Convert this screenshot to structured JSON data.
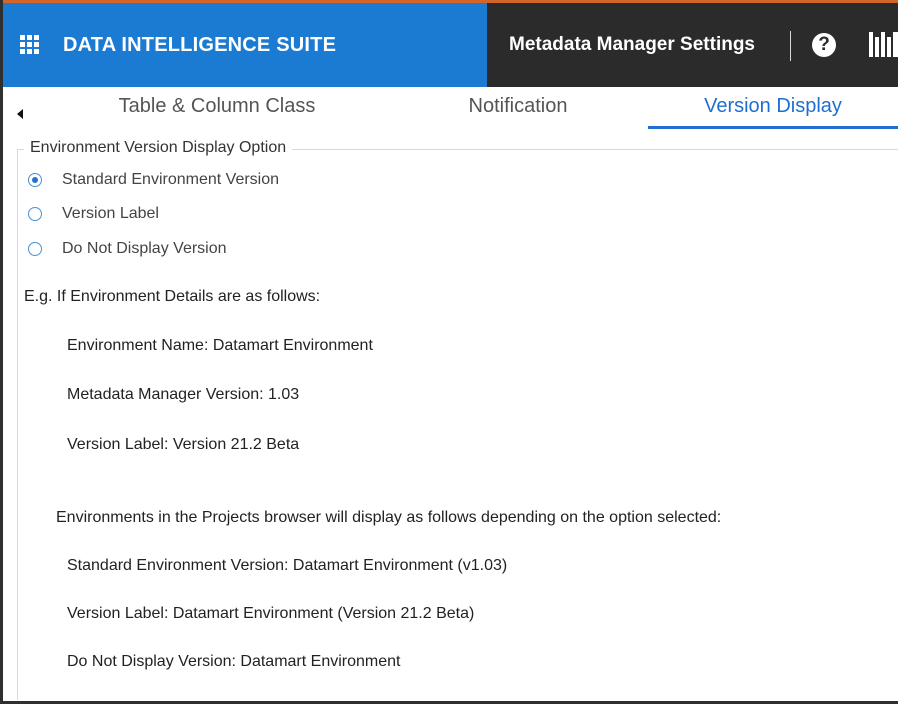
{
  "app": {
    "brand_title": "DATA INTELLIGENCE SUITE",
    "settings_title": "Metadata Manager Settings",
    "help_glyph": "?",
    "icons": [
      "apps-grid-icon",
      "help-icon",
      "library-icon",
      "scroll-left-icon"
    ],
    "colors": {
      "brand_blue": "#1b7bd3",
      "dark_bar": "#2b2b2b",
      "active_tab": "#1f6fd1"
    }
  },
  "tabs": [
    {
      "label": "Table & Column Class",
      "active": false
    },
    {
      "label": "Notification",
      "active": false
    },
    {
      "label": "Version Display",
      "active": true
    }
  ],
  "section": {
    "legend": "Environment Version Display Option",
    "options": [
      {
        "label": "Standard Environment Version",
        "selected": true
      },
      {
        "label": "Version Label",
        "selected": false
      },
      {
        "label": "Do Not Display Version",
        "selected": false
      }
    ]
  },
  "example": {
    "intro": "E.g. If Environment Details are as follows:",
    "details": [
      "Environment Name: Datamart Environment",
      "Metadata Manager Version: 1.03",
      "Version Label: Version 21.2 Beta"
    ],
    "display_intro": "Environments in the Projects browser will display as follows depending on the option selected:",
    "display_examples": [
      "Standard Environment Version: Datamart Environment (v1.03)",
      "Version Label: Datamart Environment (Version 21.2 Beta)",
      "Do Not Display Version: Datamart Environment"
    ]
  }
}
